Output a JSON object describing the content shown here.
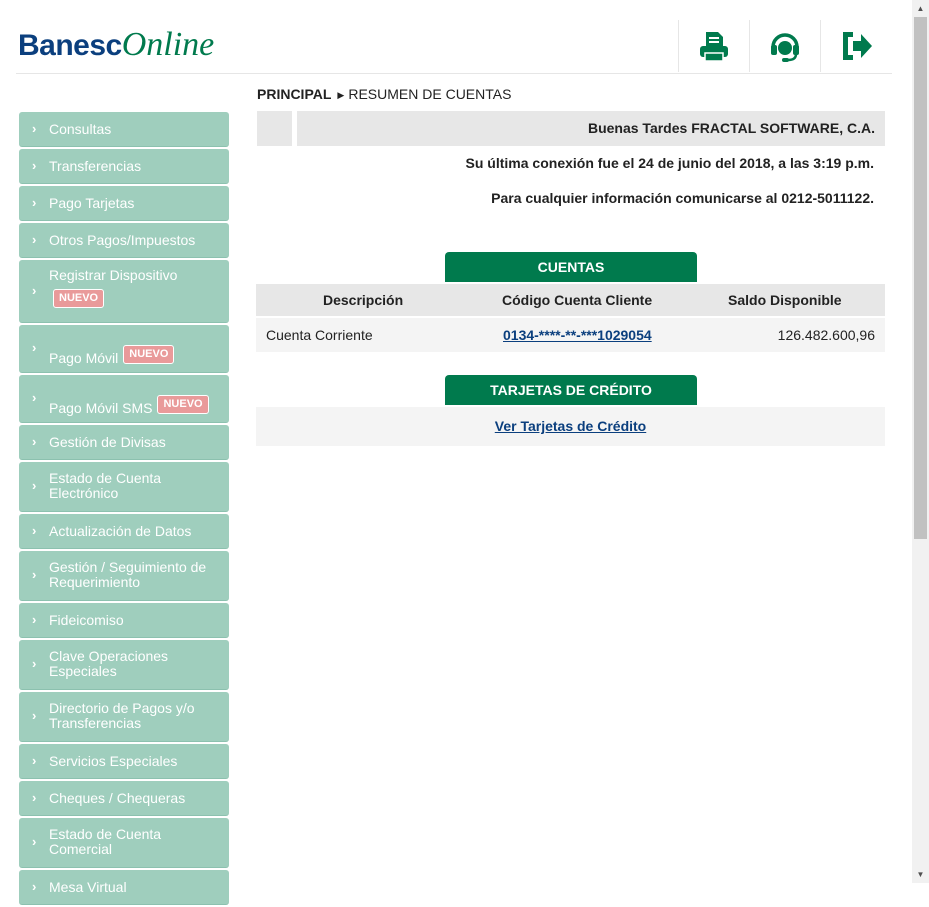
{
  "header": {
    "logo_part1": "Banesc",
    "logo_part2": "Online",
    "icons": [
      "print-icon",
      "support-headset-icon",
      "logout-icon"
    ]
  },
  "breadcrumb": {
    "root": "PRINCIPAL",
    "current": "RESUMEN DE CUENTAS"
  },
  "greeting": "Buenas Tardes FRACTAL SOFTWARE, C.A.",
  "last_connection": "Su última conexión fue el 24 de junio del 2018, a las 3:19 p.m.",
  "contact_info": "Para cualquier información comunicarse al 0212-5011122.",
  "accounts": {
    "tab_label": "CUENTAS",
    "columns": [
      "Descripción",
      "Código Cuenta Cliente",
      "Saldo Disponible"
    ],
    "rows": [
      {
        "description": "Cuenta Corriente",
        "code": "0134-****-**-***1029054",
        "balance": "126.482.600,96"
      }
    ]
  },
  "credit_cards": {
    "tab_label": "TARJETAS DE CRÉDITO",
    "link_label": "Ver Tarjetas de Crédito"
  },
  "sidebar": {
    "badge_label": "NUEVO",
    "items": [
      {
        "label": "Consultas"
      },
      {
        "label": "Transferencias"
      },
      {
        "label": "Pago Tarjetas"
      },
      {
        "label": "Otros Pagos/Impuestos"
      },
      {
        "label": "Registrar Dispositivo",
        "badge": true
      },
      {
        "label": "Pago Móvil",
        "badge": true
      },
      {
        "label": "Pago Móvil SMS",
        "badge": true
      },
      {
        "label": "Gestión de Divisas"
      },
      {
        "label": "Estado de Cuenta Electrónico"
      },
      {
        "label": "Actualización de Datos"
      },
      {
        "label": "Gestión / Seguimiento de Requerimiento"
      },
      {
        "label": "Fideicomiso"
      },
      {
        "label": "Clave Operaciones Especiales"
      },
      {
        "label": "Directorio de Pagos y/o Transferencias"
      },
      {
        "label": "Servicios Especiales"
      },
      {
        "label": "Cheques / Chequeras"
      },
      {
        "label": "Estado de Cuenta Comercial"
      },
      {
        "label": "Mesa Virtual"
      }
    ]
  },
  "colors": {
    "brand_green": "#007a4d",
    "brand_blue": "#0b3f7e",
    "sidebar_green": "#9fcebd",
    "badge_pink": "#e99a9a"
  }
}
